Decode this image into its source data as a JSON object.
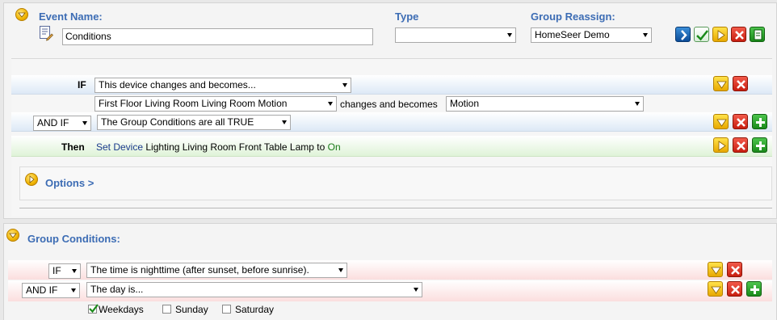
{
  "event": {
    "name_label": "Event Name:",
    "name_value": "Conditions",
    "type_label": "Type",
    "type_value": "",
    "group_label": "Group Reassign:",
    "group_value": "HomeSeer Demo"
  },
  "trigger": {
    "if_label": "IF",
    "if_condition": "This device changes and becomes...",
    "device": "First Floor Living Room Living Room Motion",
    "changes_text": "changes and becomes",
    "value": "Motion",
    "andif_select": "AND IF",
    "andif_condition": "The Group Conditions are all TRUE",
    "then_label": "Then",
    "action_link": "Set Device",
    "action_device": "Lighting Living Room Front Table Lamp",
    "action_to": "to",
    "action_value": "On",
    "options_label": "Options >"
  },
  "group_conditions": {
    "header": "Group Conditions:",
    "if_select": "IF",
    "if_condition": "The time is nighttime (after sunset, before sunrise).",
    "andif_select": "AND IF",
    "andif_condition": "The day is...",
    "days": [
      {
        "label": "Weekdays",
        "checked": true
      },
      {
        "label": "Sunday",
        "checked": false
      },
      {
        "label": "Saturday",
        "checked": false
      }
    ]
  },
  "colors": {
    "header_blue": "#3c6cb4",
    "row_blue": "#dde9f6",
    "row_green": "#dff3d8",
    "row_red": "#fbdede"
  }
}
